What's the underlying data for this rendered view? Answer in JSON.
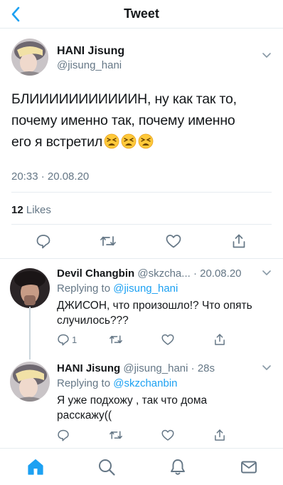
{
  "header": {
    "title": "Tweet"
  },
  "main_tweet": {
    "name": "HANI Jisung",
    "handle": "@jisung_hani",
    "text_line1": "БЛИИИИИИИИИИИН, ну как так то,",
    "text_line2": "почему именно так, почему именно",
    "text_line3": "его я встретил",
    "timestamp": "20:33 · 20.08.20",
    "likes_count": "12",
    "likes_label": "Likes"
  },
  "replies": [
    {
      "name": "Devil Changbin",
      "handle": "@skzcha...",
      "time": "· 20.08.20",
      "replying_label": "Replying to",
      "replying_to": "@jisung_hani",
      "text_line1": "ДЖИСОН, что произошло!? Что опять",
      "text_line2": "случилось???",
      "reply_count": "1"
    },
    {
      "name": "HANI Jisung",
      "handle": "@jisung_hani",
      "time": "· 28s",
      "replying_label": "Replying to",
      "replying_to": "@skzchanbin",
      "text_line1": "Я уже подхожу , так что дома",
      "text_line2": "расскажу(("
    }
  ],
  "icons": {
    "back": "chevron-left-icon",
    "reply": "speech-bubble-icon",
    "retweet": "retweet-icon",
    "like": "heart-icon",
    "share": "share-icon",
    "home": "home-icon",
    "search": "search-icon",
    "notifications": "bell-icon",
    "messages": "envelope-icon",
    "emoji": "tired-face-emoji"
  },
  "colors": {
    "accent": "#1da1f2",
    "text": "#14171a",
    "secondary": "#657786",
    "border": "#e6ecf0"
  }
}
